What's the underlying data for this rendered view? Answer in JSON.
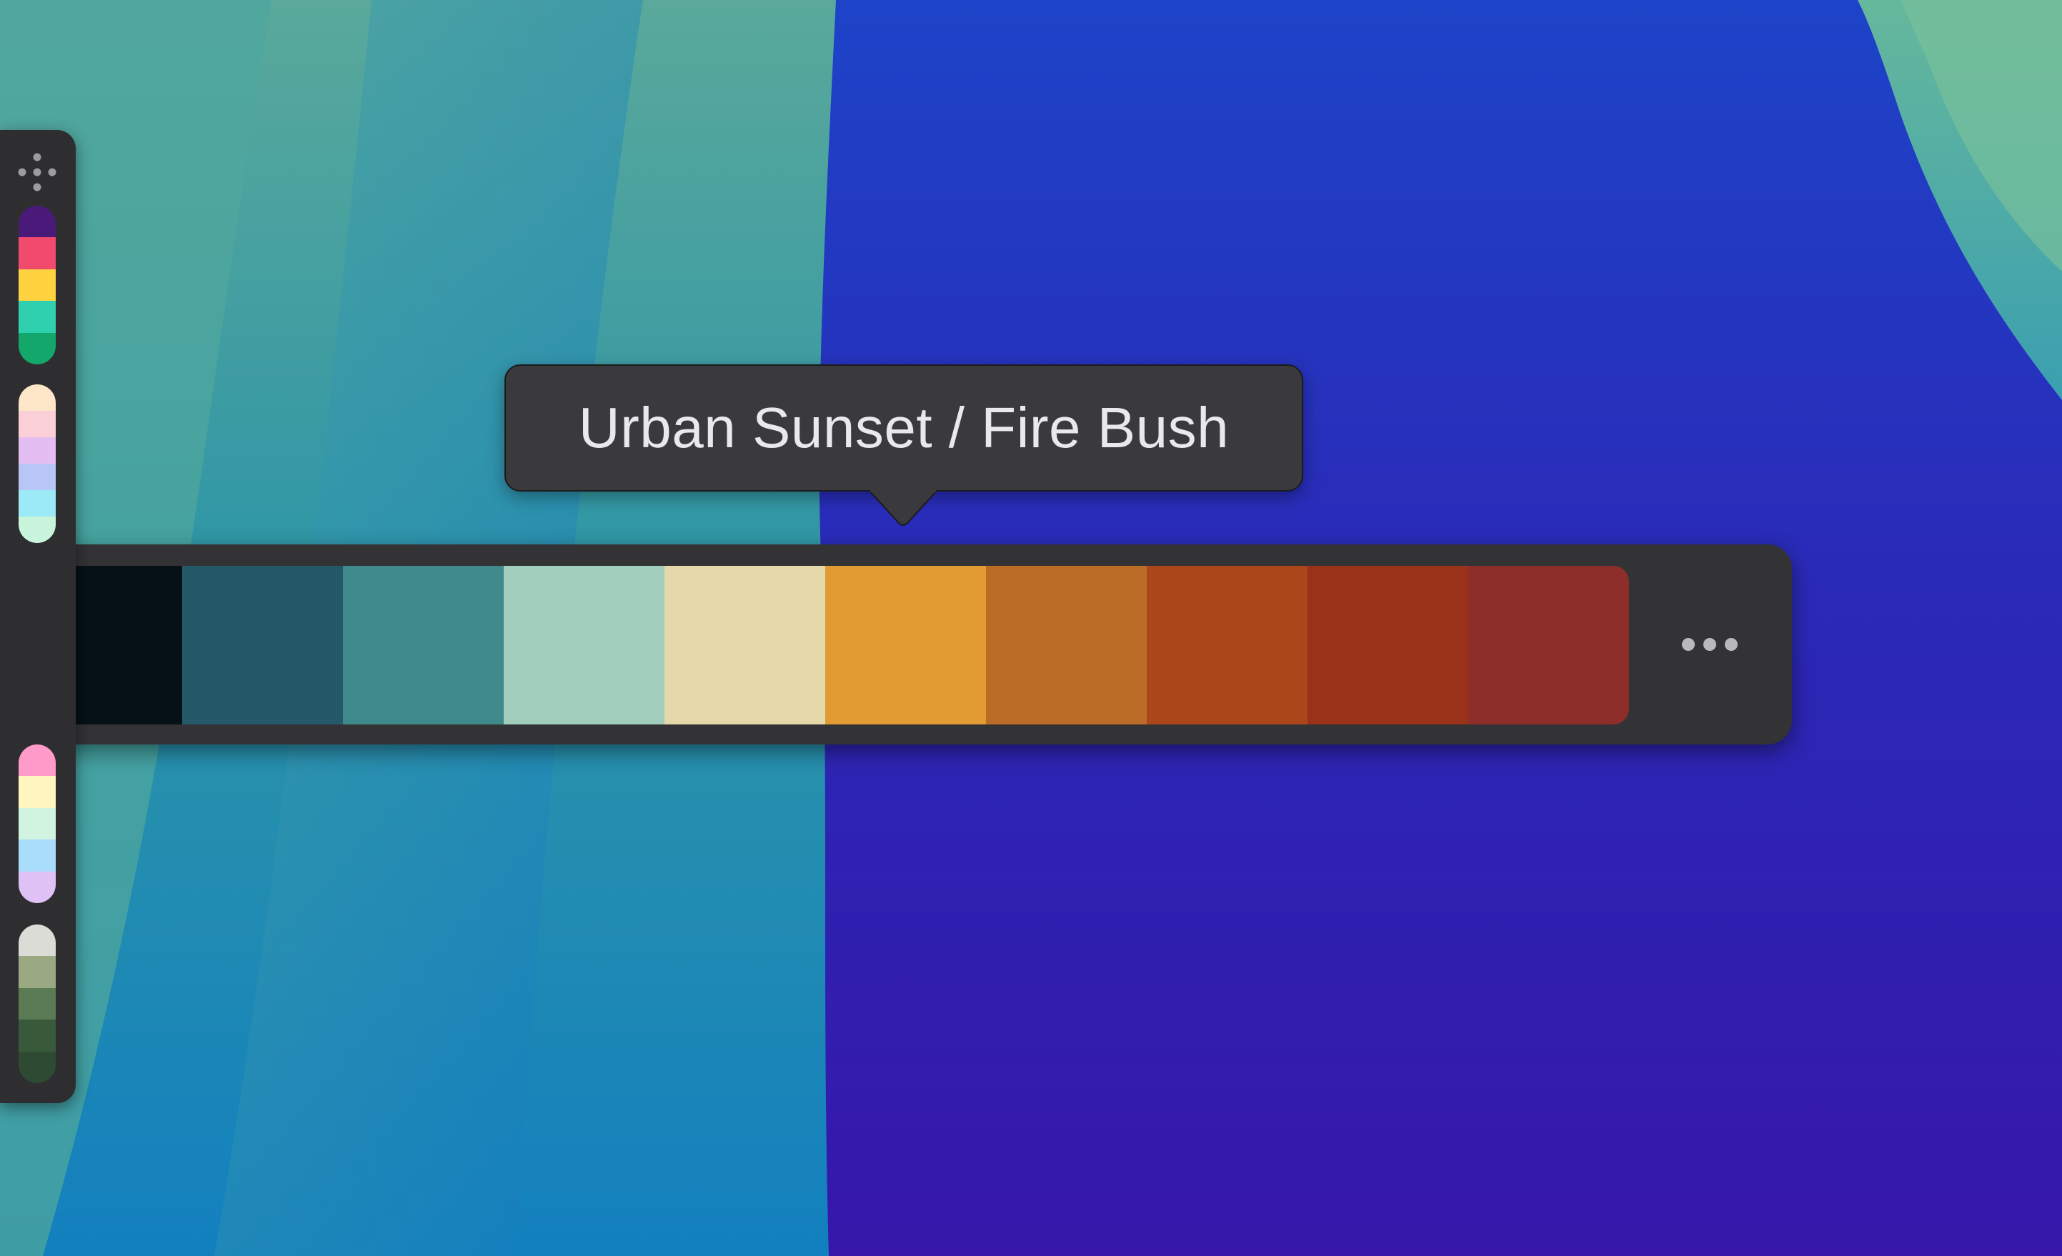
{
  "tooltip": {
    "text": "Urban Sunset / Fire Bush"
  },
  "active_palette": {
    "name": "Urban Sunset / Fire Bush",
    "colors": [
      "#051116",
      "#25596a",
      "#418a8b",
      "#a1cebd",
      "#e5d8aa",
      "#e19b32",
      "#bb6d27",
      "#aa4619",
      "#9a3119",
      "#8d2e2a"
    ]
  },
  "menu": {
    "icon": "ellipsis-icon"
  },
  "rail": {
    "handle_icon": "drag-move-icon",
    "palettes": [
      {
        "colors": [
          "#4a1a7a",
          "#f24a6e",
          "#ffd23f",
          "#2fd0ae",
          "#13a76b"
        ]
      },
      {
        "colors": [
          "#fde7c8",
          "#fbcfd8",
          "#e4bdf2",
          "#b8c6f7",
          "#9ce9f7",
          "#c9f5dd"
        ]
      },
      {
        "colors": [
          "#ff9ac9",
          "#fff6bf",
          "#d1f4e0",
          "#aadcfb",
          "#dfc1f6"
        ]
      },
      {
        "colors": [
          "#dcdcd6",
          "#9aa981",
          "#5a7b53",
          "#385a3a",
          "#2f4a33"
        ]
      }
    ]
  }
}
